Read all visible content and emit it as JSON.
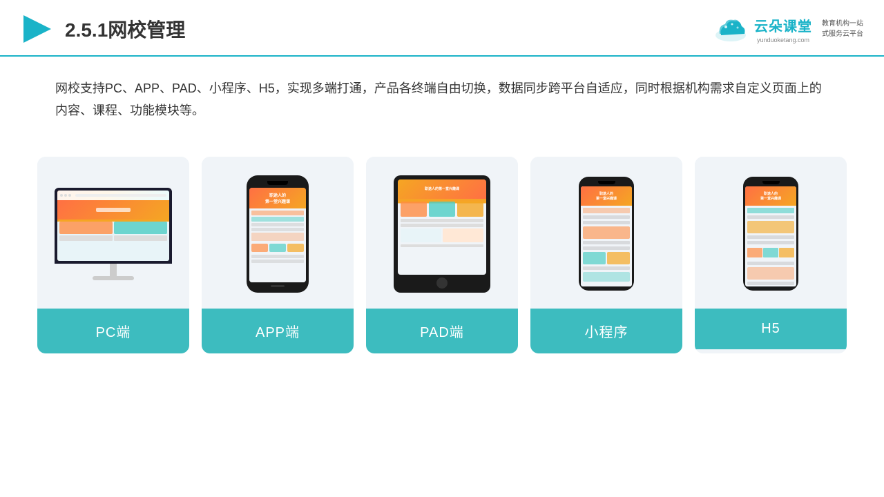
{
  "header": {
    "title": "2.5.1网校管理",
    "logo_name": "云朵课堂",
    "logo_url": "yunduoketang.com",
    "logo_tagline": "教育机构一站\n式服务云平台"
  },
  "description": {
    "text": "网校支持PC、APP、PAD、小程序、H5，实现多端打通，产品各终端自由切换，数据同步跨平台自适应，同时根据机构需求自定义页面上的内容、课程、功能模块等。"
  },
  "cards": [
    {
      "id": "pc",
      "label": "PC端"
    },
    {
      "id": "app",
      "label": "APP端"
    },
    {
      "id": "pad",
      "label": "PAD端"
    },
    {
      "id": "miniprogram",
      "label": "小程序"
    },
    {
      "id": "h5",
      "label": "H5"
    }
  ],
  "accent_color": "#3dbcbf",
  "border_color": "#1ab3c8"
}
